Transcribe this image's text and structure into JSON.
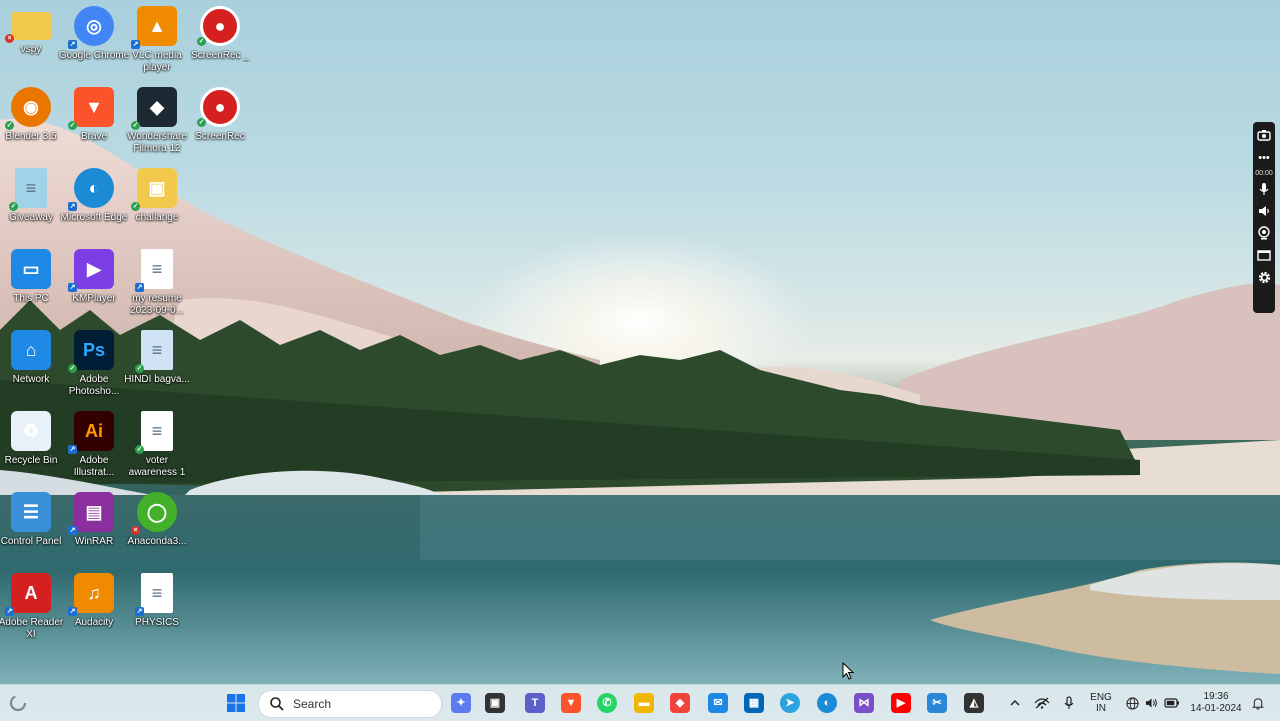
{
  "desktop": {
    "icons": [
      {
        "label": "vspy",
        "icon": "folder-icon",
        "color": "#f2c94c"
      },
      {
        "label": "Google Chrome",
        "icon": "chrome-icon",
        "color": "#4285f4"
      },
      {
        "label": "VLC media player",
        "icon": "vlc-cone-icon",
        "color": "#f08a00"
      },
      {
        "label": "ScreenRec _",
        "icon": "record-icon",
        "color": "#d62020"
      },
      {
        "label": "Blender 3.5",
        "icon": "blender-icon",
        "color": "#ea7600"
      },
      {
        "label": "Brave",
        "icon": "brave-lion-icon",
        "color": "#fb542b"
      },
      {
        "label": "Wondershare Filmora 12",
        "icon": "filmora-icon",
        "color": "#1e2a33"
      },
      {
        "label": "ScreenRec",
        "icon": "record-icon",
        "color": "#d62020"
      },
      {
        "label": "Giveaway",
        "icon": "document-icon",
        "color": "#9fd3e8"
      },
      {
        "label": "Microsoft Edge",
        "icon": "edge-icon",
        "color": "#1c8bd6"
      },
      {
        "label": "challange",
        "icon": "photo-folder-icon",
        "color": "#f2c94c"
      },
      {
        "label": "This PC",
        "icon": "monitor-icon",
        "color": "#1e88e5"
      },
      {
        "label": "KMPlayer",
        "icon": "kmplayer-icon",
        "color": "#7b3fe4"
      },
      {
        "label": "my resume 2023-09-0...",
        "icon": "document-icon",
        "color": "#ffffff"
      },
      {
        "label": "Network",
        "icon": "network-icon",
        "color": "#1e88e5"
      },
      {
        "label": "Adobe Photosho...",
        "icon": "photoshop-icon",
        "color": "#001e36"
      },
      {
        "label": "HINDI bagva...",
        "icon": "document-icon",
        "color": "#cfe3f5"
      },
      {
        "label": "Recycle Bin",
        "icon": "recycle-bin-icon",
        "color": "#e8f1f8"
      },
      {
        "label": "Adobe Illustrat...",
        "icon": "illustrator-icon",
        "color": "#330000"
      },
      {
        "label": "voter awareness 1",
        "icon": "document-icon",
        "color": "#ffffff"
      },
      {
        "label": "Control Panel",
        "icon": "control-panel-icon",
        "color": "#3a8fd9"
      },
      {
        "label": "WinRAR",
        "icon": "winrar-icon",
        "color": "#8b2f9e"
      },
      {
        "label": "Anaconda3...",
        "icon": "anaconda-icon",
        "color": "#43b02a"
      },
      {
        "label": "Adobe Reader XI",
        "icon": "acrobat-icon",
        "color": "#d4201f"
      },
      {
        "label": "Audacity",
        "icon": "audacity-icon",
        "color": "#f08a00"
      },
      {
        "label": "PHYSICS",
        "icon": "document-icon",
        "color": "#ffffff"
      }
    ]
  },
  "screenrec_panel": {
    "timer": "00:00",
    "tools": [
      "camera-icon",
      "more-icon",
      "microphone-icon",
      "speaker-icon",
      "webcam-icon",
      "window-icon",
      "settings-gear-icon"
    ]
  },
  "taskbar": {
    "search": {
      "placeholder": "Search"
    },
    "apps": [
      {
        "name": "copilot-icon",
        "color": "#5b7cf0"
      },
      {
        "name": "task-view-icon",
        "color": "#333333"
      },
      {
        "name": "teams-icon",
        "color": "#5b5fc7"
      },
      {
        "name": "brave-icon",
        "color": "#fb542b"
      },
      {
        "name": "whatsapp-icon",
        "color": "#25d366"
      },
      {
        "name": "file-explorer-icon",
        "color": "#f2b705"
      },
      {
        "name": "anydesk-icon",
        "color": "#ef443b"
      },
      {
        "name": "app-store-icon",
        "color": "#1e88e5"
      },
      {
        "name": "ms-store-icon",
        "color": "#0067b8"
      },
      {
        "name": "telegram-icon",
        "color": "#2aa3df"
      },
      {
        "name": "edge-icon",
        "color": "#1c8bd6"
      },
      {
        "name": "visual-studio-icon",
        "color": "#7b4fc7"
      },
      {
        "name": "youtube-icon",
        "color": "#ff0000"
      },
      {
        "name": "snipping-tool-icon",
        "color": "#2b88d8"
      },
      {
        "name": "inkscape-icon",
        "color": "#333333"
      }
    ],
    "tray": {
      "language_top": "ENG",
      "language_bottom": "IN",
      "time": "19:36",
      "date": "14-01-2024"
    }
  }
}
